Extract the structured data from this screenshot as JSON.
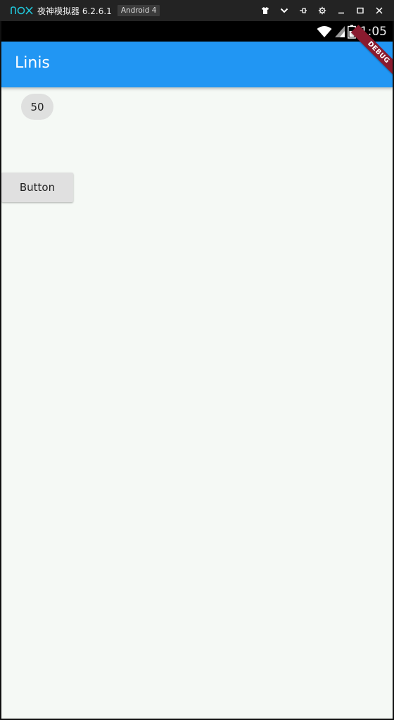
{
  "emulator": {
    "logo_text": "nox",
    "title": "夜神模拟器 6.2.6.1",
    "android_badge": "Android 4",
    "controls": [
      "shirt-icon",
      "chevron-down-icon",
      "pin-icon",
      "gear-icon",
      "minimize-icon",
      "maximize-icon",
      "close-icon"
    ]
  },
  "status_bar": {
    "time": "1:05",
    "icons": [
      "wifi-icon",
      "signal-icon",
      "battery-icon"
    ]
  },
  "app_bar": {
    "title": "Linis",
    "color": "#2196f3",
    "debug_banner": "DEBUG"
  },
  "content": {
    "chip_label": "50",
    "button_label": "Button",
    "background": "#f5f9f5"
  }
}
